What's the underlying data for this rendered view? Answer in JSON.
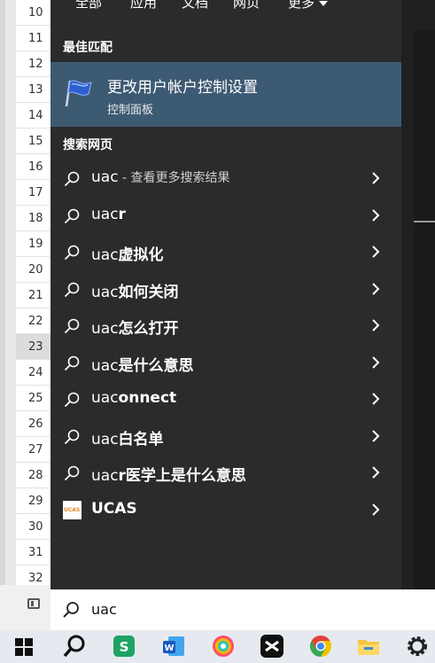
{
  "sheet": {
    "rows": [
      "10",
      "11",
      "12",
      "13",
      "14",
      "15",
      "16",
      "17",
      "18",
      "19",
      "20",
      "21",
      "22",
      "23",
      "24",
      "25",
      "26",
      "27",
      "28",
      "29",
      "30",
      "31",
      "32"
    ],
    "selected_row": "23"
  },
  "tabs": [
    {
      "label": "全部"
    },
    {
      "label": "应用"
    },
    {
      "label": "文档"
    },
    {
      "label": "网页"
    },
    {
      "label": "更多"
    }
  ],
  "best_match": {
    "section_title": "最佳匹配",
    "title": "更改用户帐户控制设置",
    "subtitle": "控制面板",
    "icon": "uac-flag-icon"
  },
  "web_section_title": "搜索网页",
  "results": [
    {
      "query": "uac",
      "bold": "",
      "suffix": " - 查看更多搜索结果",
      "icon": "search-icon"
    },
    {
      "query": "uac",
      "bold": "r",
      "suffix": "",
      "icon": "search-icon"
    },
    {
      "query": "uac",
      "bold": "虚拟化",
      "suffix": "",
      "icon": "search-icon"
    },
    {
      "query": "uac",
      "bold": "如何关闭",
      "suffix": "",
      "icon": "search-icon"
    },
    {
      "query": "uac",
      "bold": "怎么打开",
      "suffix": "",
      "icon": "search-icon"
    },
    {
      "query": "uac",
      "bold": "是什么意思",
      "suffix": "",
      "icon": "search-icon"
    },
    {
      "query": "uac",
      "bold": "onnect",
      "suffix": "",
      "icon": "search-icon"
    },
    {
      "query": "uac",
      "bold": "白名单",
      "suffix": "",
      "icon": "search-icon"
    },
    {
      "query": "uac",
      "bold": "r医学上是什么意思",
      "suffix": "",
      "icon": "search-icon"
    },
    {
      "query": "",
      "bold": "UCAS",
      "suffix": "",
      "icon": "ucas-logo-icon"
    }
  ],
  "search": {
    "value": "uac"
  },
  "ucas_logo_text": "UCAS",
  "taskbar": [
    "windows-start-icon",
    "search-icon",
    "wps-sheet-icon",
    "word-icon",
    "color-app-icon",
    "capcut-icon",
    "chrome-icon",
    "file-explorer-icon",
    "settings-icon"
  ],
  "colors": {
    "highlight": "#3d5a73",
    "panel": "#2b2b2b"
  }
}
